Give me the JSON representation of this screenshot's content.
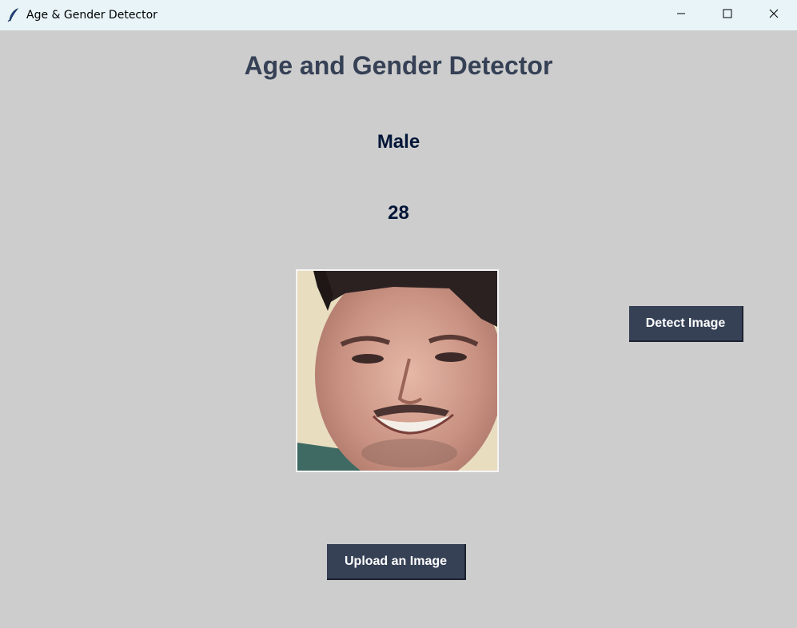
{
  "window": {
    "title": "Age & Gender Detector",
    "icon": "feather-icon",
    "controls": [
      "minimize-icon",
      "maximize-icon",
      "close-icon"
    ]
  },
  "main": {
    "heading": "Age and Gender Detector",
    "gender_result": "Male",
    "age_result": "28",
    "image_description_icon": "face-photo"
  },
  "buttons": {
    "detect_label": "Detect Image",
    "upload_label": "Upload an Image"
  },
  "colors": {
    "background": "#cdcdcd",
    "heading": "#364156",
    "result_text": "#011638",
    "button_bg": "#364156",
    "button_text": "#ffffff",
    "titlebar": "#e8f4f8"
  }
}
